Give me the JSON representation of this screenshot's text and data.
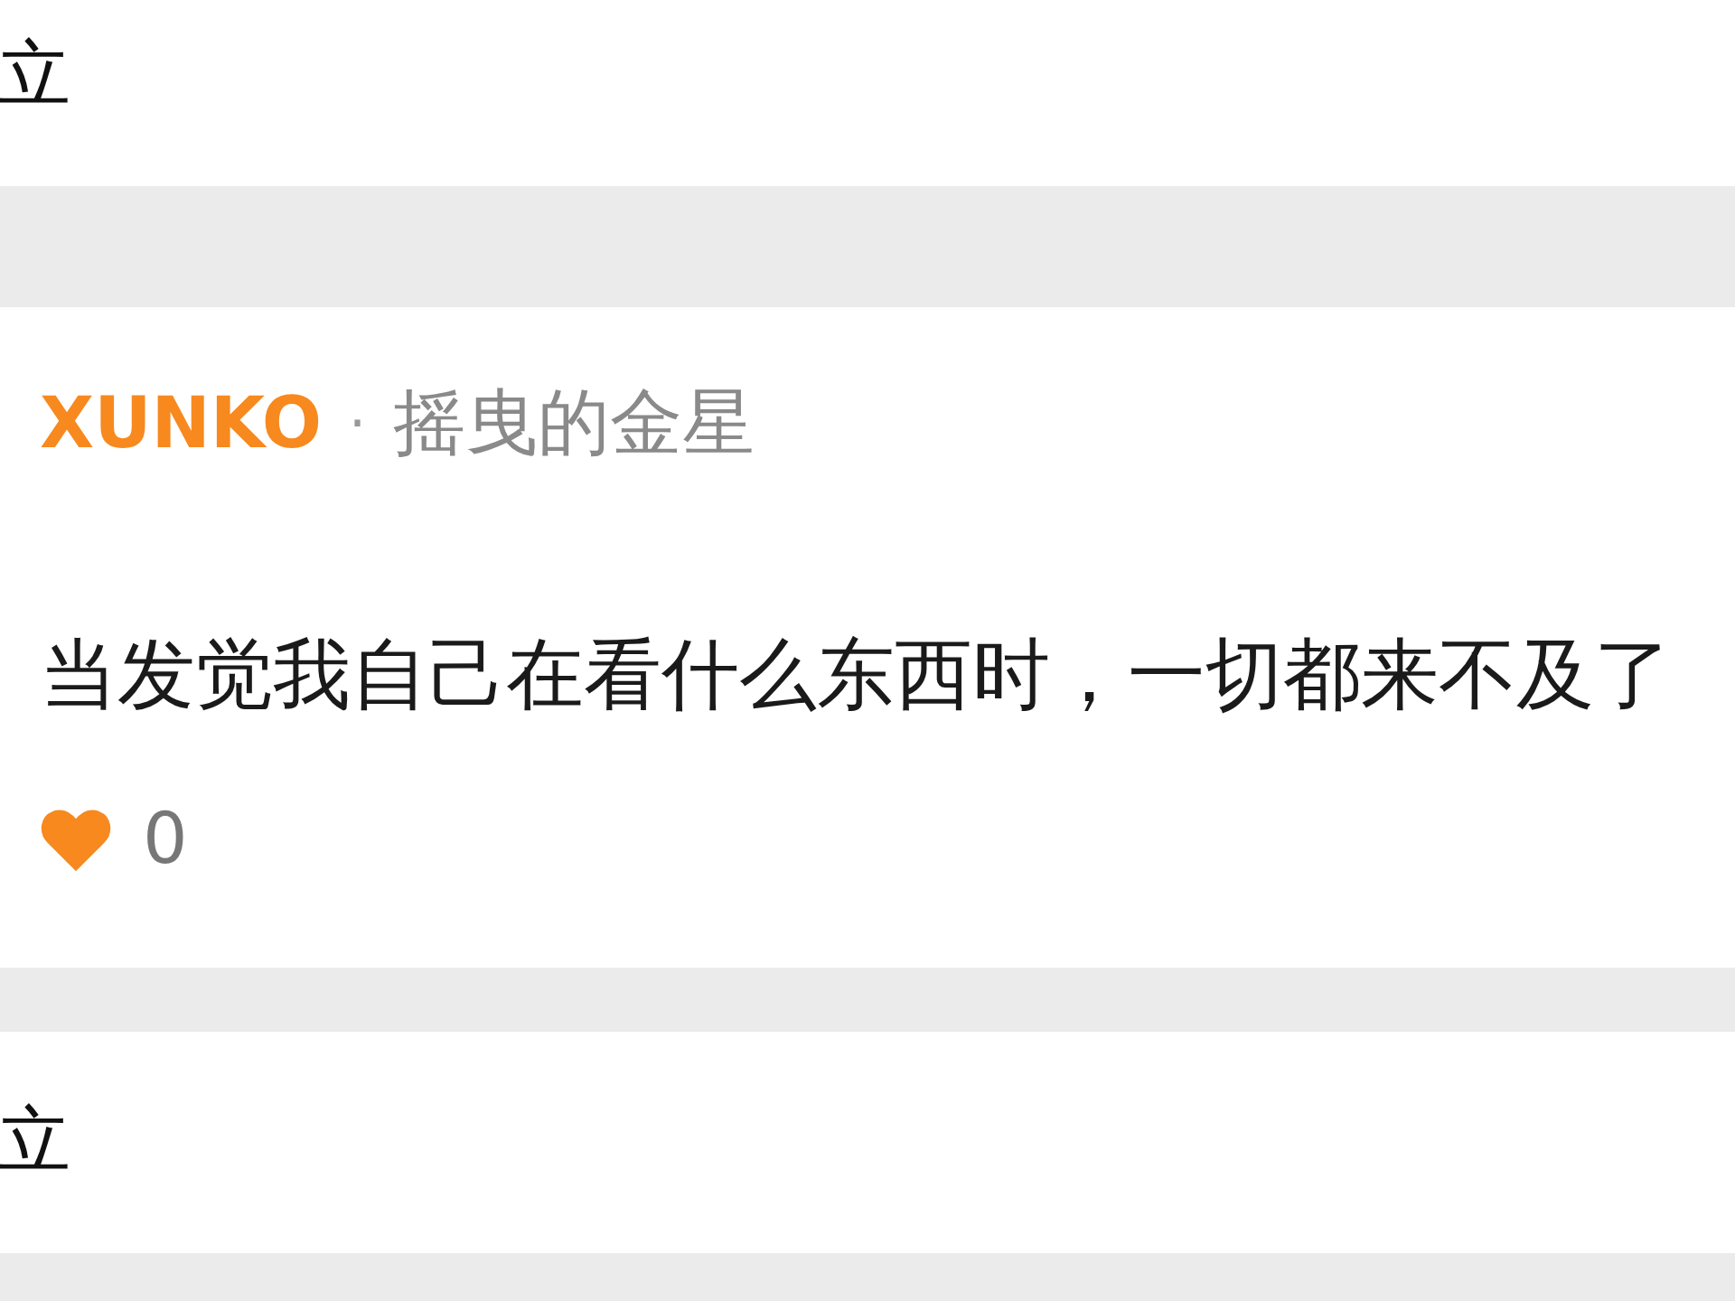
{
  "items": [
    {
      "kind": "fragment",
      "text": "立"
    },
    {
      "kind": "comment",
      "username": "XUNKO",
      "separator": "·",
      "subtitle": "摇曳的金星",
      "body": "当发觉我自己在看什么东西时，一切都来不及了",
      "likes": "0",
      "liked": true
    },
    {
      "kind": "fragment",
      "text": "立"
    }
  ]
}
